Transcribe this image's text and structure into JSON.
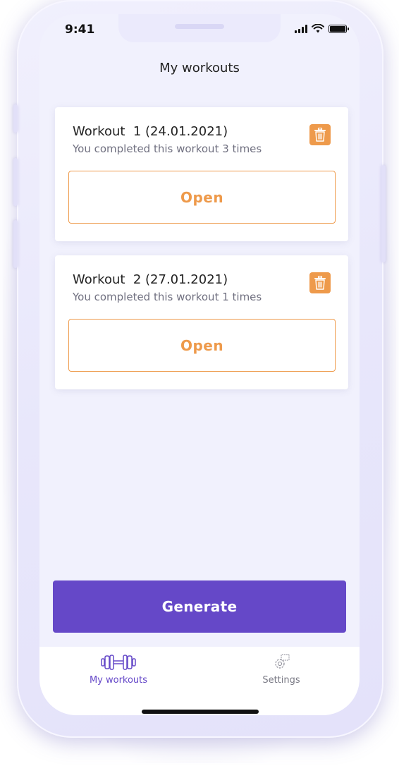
{
  "status_bar": {
    "time": "9:41"
  },
  "header": {
    "title": "My workouts"
  },
  "workouts": [
    {
      "title": "Workout  1 (24.01.2021)",
      "subtitle": "You completed this workout 3 times",
      "open_label": "Open"
    },
    {
      "title": "Workout  2 (27.01.2021)",
      "subtitle": "You completed this workout 1 times",
      "open_label": "Open"
    }
  ],
  "generate_label": "Generate",
  "tabbar": {
    "items": [
      {
        "label": "My workouts",
        "icon": "dumbbell-icon",
        "active": true
      },
      {
        "label": "Settings",
        "icon": "gear-icon",
        "active": false
      }
    ]
  },
  "colors": {
    "accent_orange": "#ee9a4b",
    "primary_purple": "#6548c8",
    "screen_bg": "#f1f1fd"
  }
}
